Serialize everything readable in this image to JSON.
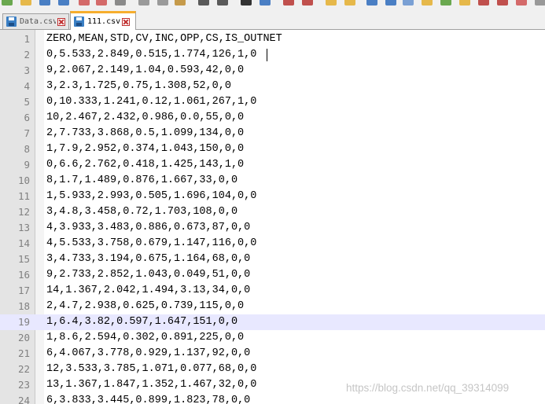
{
  "tabs": [
    {
      "label": "Data.csv",
      "active": false,
      "icon": "save-icon",
      "close_icon": "close-icon"
    },
    {
      "label": "111.csv",
      "active": true,
      "icon": "save-icon",
      "close_icon": "close-icon"
    }
  ],
  "editor": {
    "current_line": 19,
    "current_line_highlight": "#e8e8ff",
    "lines": [
      {
        "num": "1",
        "text": "ZERO,MEAN,STD,CV,INC,OPP,CS,IS_OUTNET"
      },
      {
        "num": "2",
        "text": "0,5.533,2.849,0.515,1.774,126,1,0"
      },
      {
        "num": "3",
        "text": "9,2.067,2.149,1.04,0.593,42,0,0"
      },
      {
        "num": "4",
        "text": "3,2.3,1.725,0.75,1.308,52,0,0"
      },
      {
        "num": "5",
        "text": "0,10.333,1.241,0.12,1.061,267,1,0"
      },
      {
        "num": "6",
        "text": "10,2.467,2.432,0.986,0.0,55,0,0"
      },
      {
        "num": "7",
        "text": "2,7.733,3.868,0.5,1.099,134,0,0"
      },
      {
        "num": "8",
        "text": "1,7.9,2.952,0.374,1.043,150,0,0"
      },
      {
        "num": "9",
        "text": "0,6.6,2.762,0.418,1.425,143,1,0"
      },
      {
        "num": "10",
        "text": "8,1.7,1.489,0.876,1.667,33,0,0"
      },
      {
        "num": "11",
        "text": "1,5.933,2.993,0.505,1.696,104,0,0"
      },
      {
        "num": "12",
        "text": "3,4.8,3.458,0.72,1.703,108,0,0"
      },
      {
        "num": "13",
        "text": "4,3.933,3.483,0.886,0.673,87,0,0"
      },
      {
        "num": "14",
        "text": "4,5.533,3.758,0.679,1.147,116,0,0"
      },
      {
        "num": "15",
        "text": "3,4.733,3.194,0.675,1.164,68,0,0"
      },
      {
        "num": "16",
        "text": "9,2.733,2.852,1.043,0.049,51,0,0"
      },
      {
        "num": "17",
        "text": "14,1.367,2.042,1.494,3.13,34,0,0"
      },
      {
        "num": "18",
        "text": "2,4.7,2.938,0.625,0.739,115,0,0"
      },
      {
        "num": "19",
        "text": "1,6.4,3.82,0.597,1.647,151,0,0"
      },
      {
        "num": "20",
        "text": "1,8.6,2.594,0.302,0.891,225,0,0"
      },
      {
        "num": "21",
        "text": "6,4.067,3.778,0.929,1.137,92,0,0"
      },
      {
        "num": "22",
        "text": "12,3.533,3.785,1.071,0.077,68,0,0"
      },
      {
        "num": "23",
        "text": "13,1.367,1.847,1.352,1.467,32,0,0"
      },
      {
        "num": "24",
        "text": "6,3.833,3.445,0.899,1.823,78,0,0"
      }
    ]
  },
  "watermark": "https://blog.csdn.net/qq_39314099",
  "colors": {
    "active_tab_accent": "#f6ae2d",
    "gutter_bg": "#e4e4e4",
    "line_number": "#808080"
  }
}
